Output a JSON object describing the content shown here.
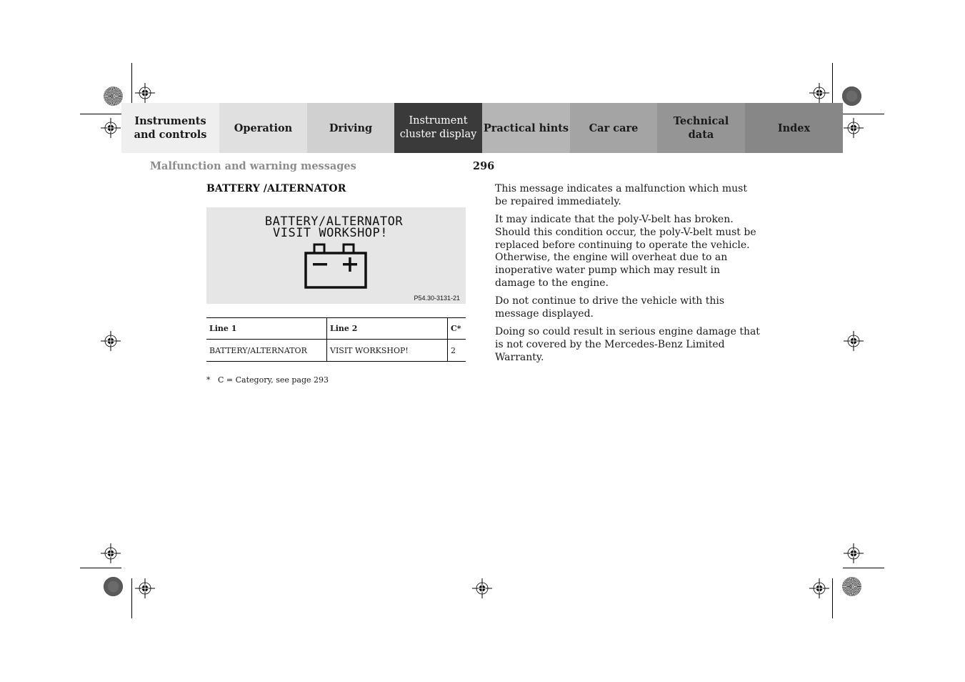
{
  "nav_tabs": [
    {
      "label": "Instruments\nand controls",
      "line1": "Instruments",
      "line2": "and controls",
      "active": false
    },
    {
      "label": "Operation",
      "line1": "Operation",
      "line2": "",
      "active": false
    },
    {
      "label": "Driving",
      "line1": "Driving",
      "line2": "",
      "active": false
    },
    {
      "label": "Instrument\ncluster display",
      "line1": "Instrument",
      "line2": "cluster display",
      "active": true
    },
    {
      "label": "Practical hints",
      "line1": "Practical hints",
      "line2": "",
      "active": false
    },
    {
      "label": "Car care",
      "line1": "Car care",
      "line2": "",
      "active": false
    },
    {
      "label": "Technical\ndata",
      "line1": "Technical",
      "line2": "data",
      "active": false
    },
    {
      "label": "Index",
      "line1": "Index",
      "line2": "",
      "active": false
    }
  ],
  "header": {
    "section_title": "Malfunction and warning messages",
    "page_number": "296"
  },
  "content": {
    "heading": "BATTERY /ALTERNATOR",
    "display_illustration": {
      "line1": "BATTERY/ALTERNATOR",
      "line2": "VISIT WORKSHOP!",
      "icon": "battery-icon",
      "figure_code": "P54.30-3131-21"
    },
    "message_table": {
      "headers": [
        "Line 1",
        "Line 2",
        "C*"
      ],
      "rows": [
        [
          "BATTERY/ALTERNATOR",
          "VISIT WORKSHOP!",
          "2"
        ]
      ]
    },
    "footnote": {
      "marker": "*",
      "text": "C = Category, see page 293"
    },
    "paragraphs": [
      "This message indicates a malfunction which must be repaired immediately.",
      "It may indicate that the poly-V-belt has broken. Should this condition occur, the poly-V-belt must be replaced before continuing to operate the vehicle. Otherwise, the engine will overheat due to an inoperative water pump which may result in damage to the engine.",
      "Do not continue to drive the vehicle with this message displayed.",
      "Doing so could result in serious engine damage that is not covered by the Mercedes-Benz Limited Warranty."
    ]
  },
  "colors": {
    "active_tab_bg": "#3a3a3a",
    "section_title": "#8c8c8c",
    "display_bg": "#e6e6e6"
  }
}
